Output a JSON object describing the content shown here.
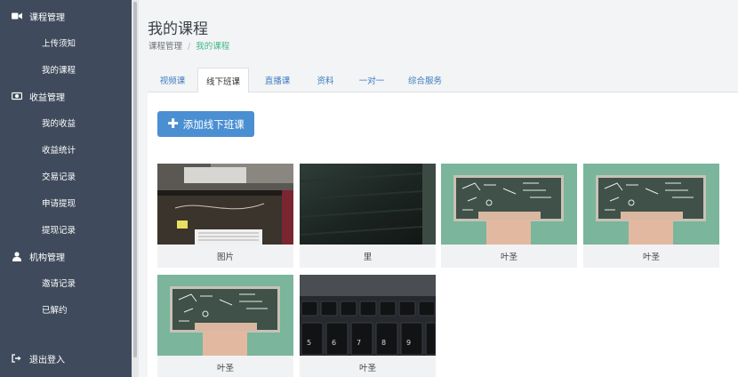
{
  "sidebar": {
    "groups": [
      {
        "label": "课程管理",
        "icon": "video-camera-icon"
      },
      {
        "label": "收益管理",
        "icon": "money-icon"
      },
      {
        "label": "机构管理",
        "icon": "user-icon"
      }
    ],
    "items": [
      {
        "label": "上传须知"
      },
      {
        "label": "我的课程"
      },
      {
        "label": "我的收益"
      },
      {
        "label": "收益统计"
      },
      {
        "label": "交易记录"
      },
      {
        "label": "申请提现"
      },
      {
        "label": "提现记录"
      },
      {
        "label": "邀请记录"
      },
      {
        "label": "已解约"
      }
    ],
    "logout": {
      "label": "退出登入",
      "icon": "sign-out-icon"
    }
  },
  "header": {
    "title": "我的课程",
    "breadcrumb": {
      "parent": "课程管理",
      "separator": "/",
      "current": "我的课程"
    }
  },
  "tabs": [
    {
      "label": "视频课"
    },
    {
      "label": "线下班课"
    },
    {
      "label": "直播课"
    },
    {
      "label": "资料"
    },
    {
      "label": "一对一"
    },
    {
      "label": "综合服务"
    }
  ],
  "active_tab": "线下班课",
  "add_button": {
    "label": "添加线下班课",
    "icon": "plus-icon"
  },
  "courses": [
    {
      "caption": "图片",
      "thumb": "desk-photo"
    },
    {
      "caption": "里",
      "thumb": "dark-wood-photo"
    },
    {
      "caption": "叶圣",
      "thumb": "classroom-blackboard"
    },
    {
      "caption": "叶圣",
      "thumb": "classroom-blackboard"
    },
    {
      "caption": "叶圣",
      "thumb": "classroom-blackboard"
    },
    {
      "caption": "叶圣",
      "thumb": "keyboard-photo"
    }
  ],
  "colors": {
    "sidebar_bg": "#3f4b5c",
    "primary": "#4b8fd3",
    "breadcrumb_active": "#41b883",
    "tab_link": "#3d7dbf"
  }
}
